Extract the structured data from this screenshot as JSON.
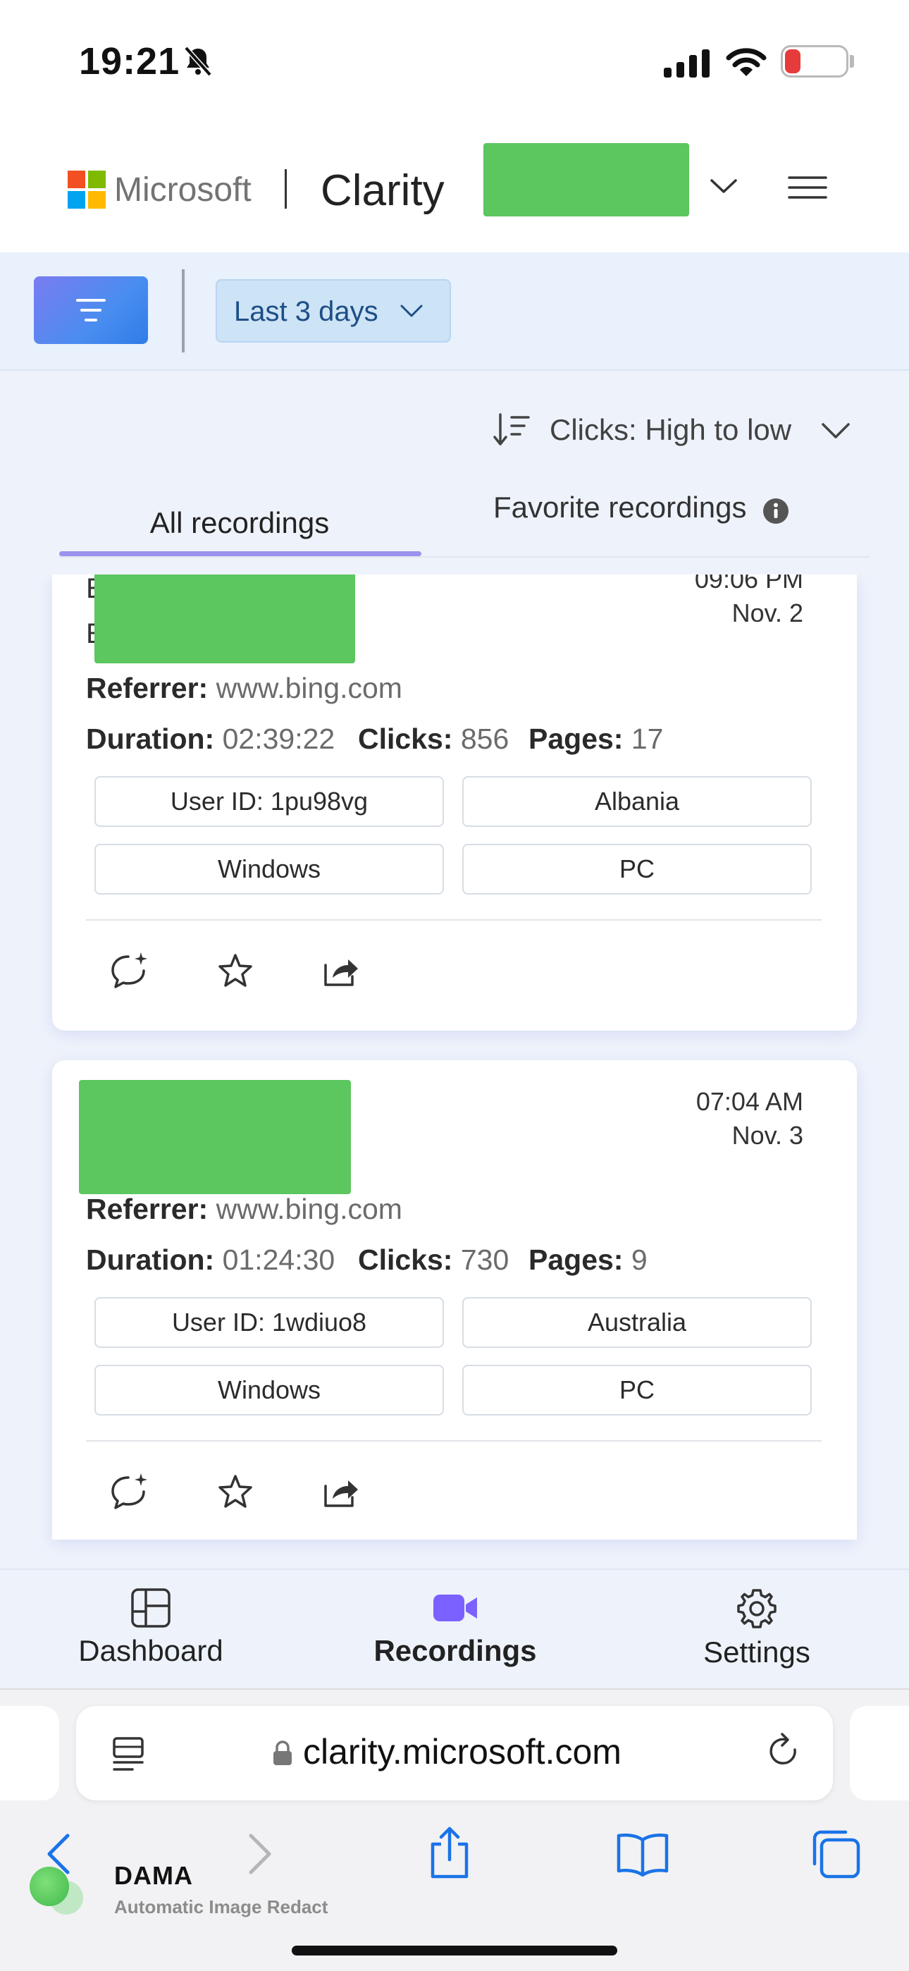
{
  "status_bar": {
    "time": "19:21",
    "battery_level": "12",
    "icons": [
      "bell-slash-icon",
      "signal-icon",
      "wifi-icon",
      "battery-icon"
    ]
  },
  "header": {
    "brand": "Microsoft",
    "product": "Clarity",
    "icons": [
      "microsoft-logo",
      "chevron-down-icon",
      "hamburger-menu-icon"
    ]
  },
  "filter_bar": {
    "date_range": "Last 3 days",
    "icons": [
      "filter-icon",
      "chevron-down-icon"
    ]
  },
  "sort": {
    "label": "Clicks: High to low",
    "icons": [
      "sort-icon",
      "chevron-down-icon"
    ]
  },
  "tabs": [
    {
      "label": "All recordings",
      "active": true
    },
    {
      "label": "Favorite recordings",
      "active": false
    }
  ],
  "recordings": [
    {
      "cut_letters": [
        "E",
        "E"
      ],
      "time": "09:06 PM",
      "date": "Nov. 2",
      "referrer_label": "Referrer:",
      "referrer": "www.bing.com",
      "duration_label": "Duration:",
      "duration": "02:39:22",
      "clicks_label": "Clicks:",
      "clicks": "856",
      "pages_label": "Pages:",
      "pages": "17",
      "user_id": "User ID: 1pu98vg",
      "country": "Albania",
      "os": "Windows",
      "device": "PC"
    },
    {
      "time": "07:04 AM",
      "date": "Nov. 3",
      "referrer_label": "Referrer:",
      "referrer": "www.bing.com",
      "duration_label": "Duration:",
      "duration": "01:24:30",
      "clicks_label": "Clicks:",
      "clicks": "730",
      "pages_label": "Pages:",
      "pages": "9",
      "user_id": "User ID: 1wdiuo8",
      "country": "Australia",
      "os": "Windows",
      "device": "PC"
    }
  ],
  "bottom_nav": [
    {
      "label": "Dashboard",
      "icon": "dashboard-icon",
      "active": false
    },
    {
      "label": "Recordings",
      "icon": "video-camera-icon",
      "active": true
    },
    {
      "label": "Settings",
      "icon": "gear-icon",
      "active": false
    }
  ],
  "browser": {
    "url": "clarity.microsoft.com",
    "toolbar_icons": [
      "back-icon",
      "forward-icon",
      "share-icon",
      "bookmarks-icon",
      "tabs-icon"
    ]
  },
  "overlay": {
    "title": "DAMA",
    "subtitle": "Automatic Image Redact"
  },
  "colors": {
    "accent": "#7b61ff",
    "tab_underline": "#9b93ee",
    "redaction": "#5cc65f",
    "date_pill_bg": "#cde3f6",
    "battery_low": "#e53b3b"
  }
}
